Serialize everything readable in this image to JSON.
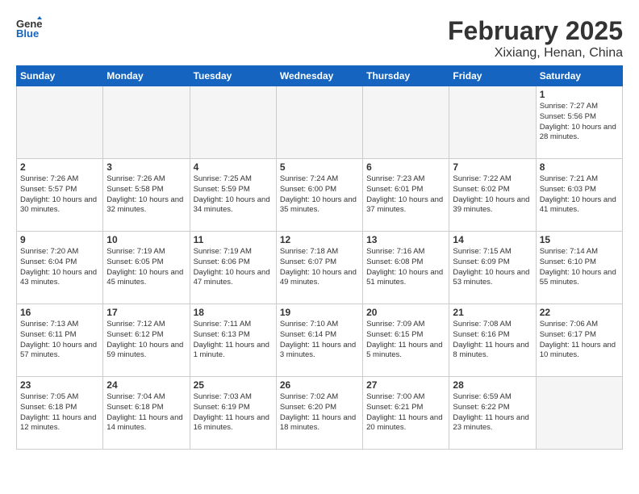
{
  "header": {
    "logo_general": "General",
    "logo_blue": "Blue",
    "month": "February 2025",
    "location": "Xixiang, Henan, China"
  },
  "weekdays": [
    "Sunday",
    "Monday",
    "Tuesday",
    "Wednesday",
    "Thursday",
    "Friday",
    "Saturday"
  ],
  "weeks": [
    [
      {
        "day": "",
        "info": ""
      },
      {
        "day": "",
        "info": ""
      },
      {
        "day": "",
        "info": ""
      },
      {
        "day": "",
        "info": ""
      },
      {
        "day": "",
        "info": ""
      },
      {
        "day": "",
        "info": ""
      },
      {
        "day": "1",
        "info": "Sunrise: 7:27 AM\nSunset: 5:56 PM\nDaylight: 10 hours and 28 minutes."
      }
    ],
    [
      {
        "day": "2",
        "info": "Sunrise: 7:26 AM\nSunset: 5:57 PM\nDaylight: 10 hours and 30 minutes."
      },
      {
        "day": "3",
        "info": "Sunrise: 7:26 AM\nSunset: 5:58 PM\nDaylight: 10 hours and 32 minutes."
      },
      {
        "day": "4",
        "info": "Sunrise: 7:25 AM\nSunset: 5:59 PM\nDaylight: 10 hours and 34 minutes."
      },
      {
        "day": "5",
        "info": "Sunrise: 7:24 AM\nSunset: 6:00 PM\nDaylight: 10 hours and 35 minutes."
      },
      {
        "day": "6",
        "info": "Sunrise: 7:23 AM\nSunset: 6:01 PM\nDaylight: 10 hours and 37 minutes."
      },
      {
        "day": "7",
        "info": "Sunrise: 7:22 AM\nSunset: 6:02 PM\nDaylight: 10 hours and 39 minutes."
      },
      {
        "day": "8",
        "info": "Sunrise: 7:21 AM\nSunset: 6:03 PM\nDaylight: 10 hours and 41 minutes."
      }
    ],
    [
      {
        "day": "9",
        "info": "Sunrise: 7:20 AM\nSunset: 6:04 PM\nDaylight: 10 hours and 43 minutes."
      },
      {
        "day": "10",
        "info": "Sunrise: 7:19 AM\nSunset: 6:05 PM\nDaylight: 10 hours and 45 minutes."
      },
      {
        "day": "11",
        "info": "Sunrise: 7:19 AM\nSunset: 6:06 PM\nDaylight: 10 hours and 47 minutes."
      },
      {
        "day": "12",
        "info": "Sunrise: 7:18 AM\nSunset: 6:07 PM\nDaylight: 10 hours and 49 minutes."
      },
      {
        "day": "13",
        "info": "Sunrise: 7:16 AM\nSunset: 6:08 PM\nDaylight: 10 hours and 51 minutes."
      },
      {
        "day": "14",
        "info": "Sunrise: 7:15 AM\nSunset: 6:09 PM\nDaylight: 10 hours and 53 minutes."
      },
      {
        "day": "15",
        "info": "Sunrise: 7:14 AM\nSunset: 6:10 PM\nDaylight: 10 hours and 55 minutes."
      }
    ],
    [
      {
        "day": "16",
        "info": "Sunrise: 7:13 AM\nSunset: 6:11 PM\nDaylight: 10 hours and 57 minutes."
      },
      {
        "day": "17",
        "info": "Sunrise: 7:12 AM\nSunset: 6:12 PM\nDaylight: 10 hours and 59 minutes."
      },
      {
        "day": "18",
        "info": "Sunrise: 7:11 AM\nSunset: 6:13 PM\nDaylight: 11 hours and 1 minute."
      },
      {
        "day": "19",
        "info": "Sunrise: 7:10 AM\nSunset: 6:14 PM\nDaylight: 11 hours and 3 minutes."
      },
      {
        "day": "20",
        "info": "Sunrise: 7:09 AM\nSunset: 6:15 PM\nDaylight: 11 hours and 5 minutes."
      },
      {
        "day": "21",
        "info": "Sunrise: 7:08 AM\nSunset: 6:16 PM\nDaylight: 11 hours and 8 minutes."
      },
      {
        "day": "22",
        "info": "Sunrise: 7:06 AM\nSunset: 6:17 PM\nDaylight: 11 hours and 10 minutes."
      }
    ],
    [
      {
        "day": "23",
        "info": "Sunrise: 7:05 AM\nSunset: 6:18 PM\nDaylight: 11 hours and 12 minutes."
      },
      {
        "day": "24",
        "info": "Sunrise: 7:04 AM\nSunset: 6:18 PM\nDaylight: 11 hours and 14 minutes."
      },
      {
        "day": "25",
        "info": "Sunrise: 7:03 AM\nSunset: 6:19 PM\nDaylight: 11 hours and 16 minutes."
      },
      {
        "day": "26",
        "info": "Sunrise: 7:02 AM\nSunset: 6:20 PM\nDaylight: 11 hours and 18 minutes."
      },
      {
        "day": "27",
        "info": "Sunrise: 7:00 AM\nSunset: 6:21 PM\nDaylight: 11 hours and 20 minutes."
      },
      {
        "day": "28",
        "info": "Sunrise: 6:59 AM\nSunset: 6:22 PM\nDaylight: 11 hours and 23 minutes."
      },
      {
        "day": "",
        "info": ""
      }
    ]
  ]
}
